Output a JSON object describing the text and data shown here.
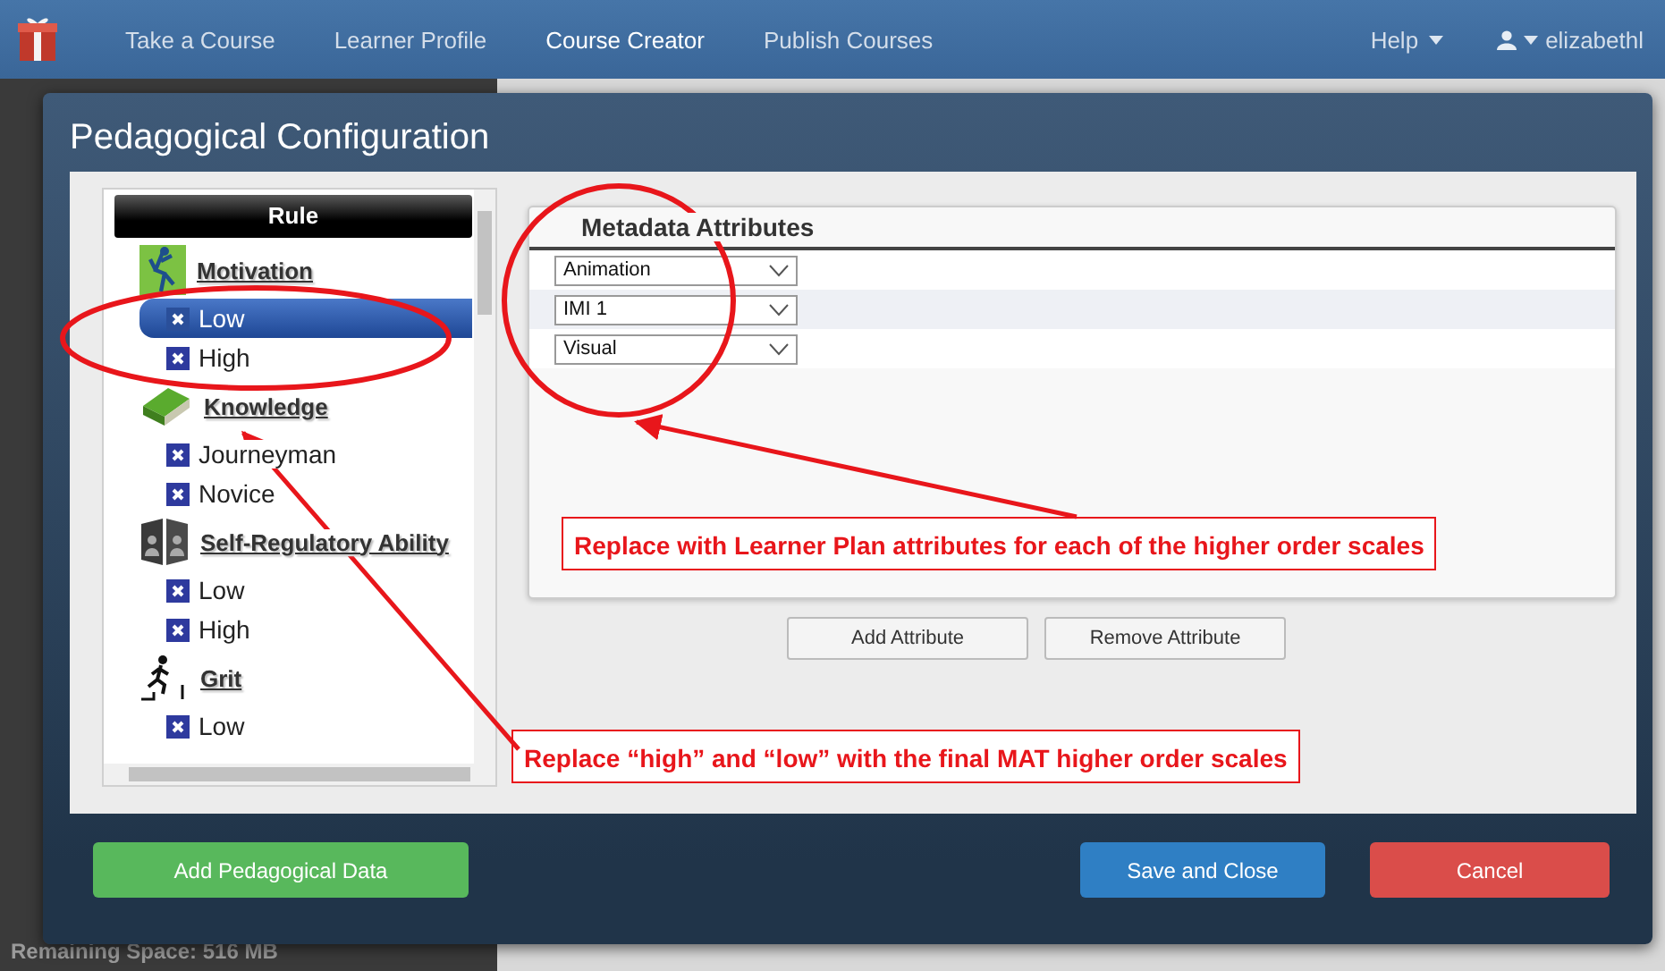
{
  "nav": {
    "items": [
      {
        "label": "Take a Course",
        "selected": false
      },
      {
        "label": "Learner Profile",
        "selected": false
      },
      {
        "label": "Course Creator",
        "selected": true
      },
      {
        "label": "Publish Courses",
        "selected": false
      }
    ],
    "help": "Help",
    "user": "elizabethl"
  },
  "background": {
    "status": "Remaining Space: 516 MB"
  },
  "dialog": {
    "title": "Pedagogical Configuration",
    "rule_header": "Rule",
    "tree": [
      {
        "label": "Motivation",
        "children": [
          {
            "label": "Low",
            "selected": true
          },
          {
            "label": "High",
            "selected": false
          }
        ]
      },
      {
        "label": "Knowledge",
        "children": [
          {
            "label": "Journeyman",
            "selected": false
          },
          {
            "label": "Novice",
            "selected": false
          }
        ]
      },
      {
        "label": "Self-Regulatory Ability",
        "children": [
          {
            "label": "Low",
            "selected": false
          },
          {
            "label": "High",
            "selected": false
          }
        ]
      },
      {
        "label": "Grit",
        "children": [
          {
            "label": "Low",
            "selected": false
          }
        ]
      }
    ],
    "attributes_title": "Metadata Attributes",
    "attributes": [
      {
        "value": "Animation"
      },
      {
        "value": "IMI 1"
      },
      {
        "value": "Visual"
      }
    ],
    "attribute_buttons": [
      "Add Attribute",
      "Remove Attribute"
    ],
    "footer_buttons": [
      {
        "label": "Add Pedagogical Data",
        "kind": "success"
      },
      {
        "label": "Save and Close",
        "kind": "primary"
      },
      {
        "label": "Cancel",
        "kind": "danger"
      }
    ]
  },
  "annotations": [
    {
      "text": "Replace with Learner Plan attributes for each of the higher order scales"
    },
    {
      "text": "Replace “high” and “low” with the final MAT higher order scales"
    }
  ]
}
